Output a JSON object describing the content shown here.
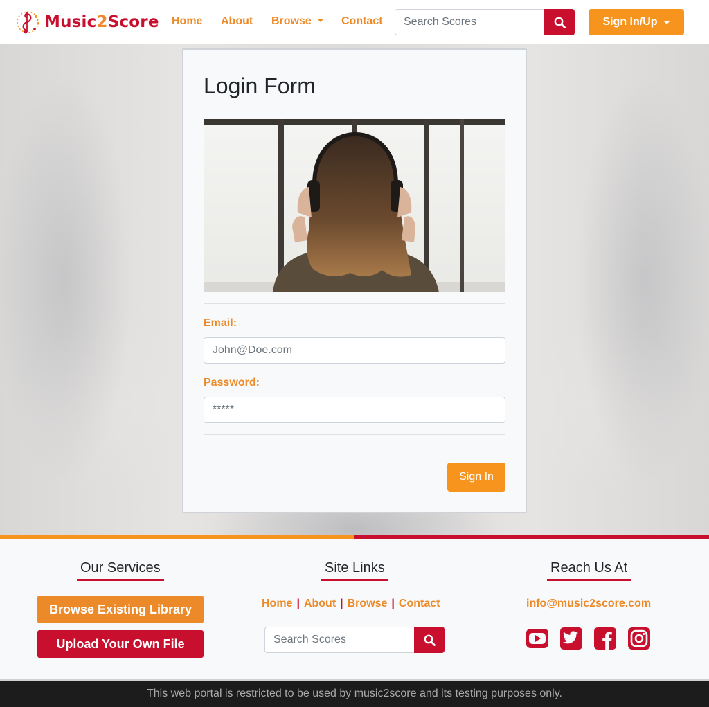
{
  "brand": {
    "name_part1": "Music",
    "name_part2": "2",
    "name_part3": "Score"
  },
  "nav": {
    "home": "Home",
    "about": "About",
    "browse": "Browse",
    "contact": "Contact",
    "search_placeholder": "Search Scores",
    "sign_in_up": "Sign In/Up"
  },
  "login": {
    "title": "Login Form",
    "email_label": "Email:",
    "email_placeholder": "John@Doe.com",
    "password_label": "Password:",
    "password_placeholder": "*****",
    "submit": "Sign In"
  },
  "footer": {
    "services": {
      "heading": "Our Services",
      "browse_button": "Browse Existing Library",
      "upload_button": "Upload Your Own File"
    },
    "site_links": {
      "heading": "Site Links",
      "links": [
        "Home",
        "About",
        "Browse",
        "Contact"
      ],
      "separator": "|",
      "search_placeholder": "Search Scores"
    },
    "reach": {
      "heading": "Reach Us At",
      "email": "info@music2score.com",
      "social": [
        "youtube-icon",
        "twitter-icon",
        "facebook-icon",
        "instagram-icon"
      ]
    },
    "disclaimer": "This web portal is restricted to be used by music2score and its testing purposes only."
  },
  "colors": {
    "brand_red": "#c8102e",
    "brand_orange": "#f7941d",
    "link_orange": "#ec8a2a"
  }
}
